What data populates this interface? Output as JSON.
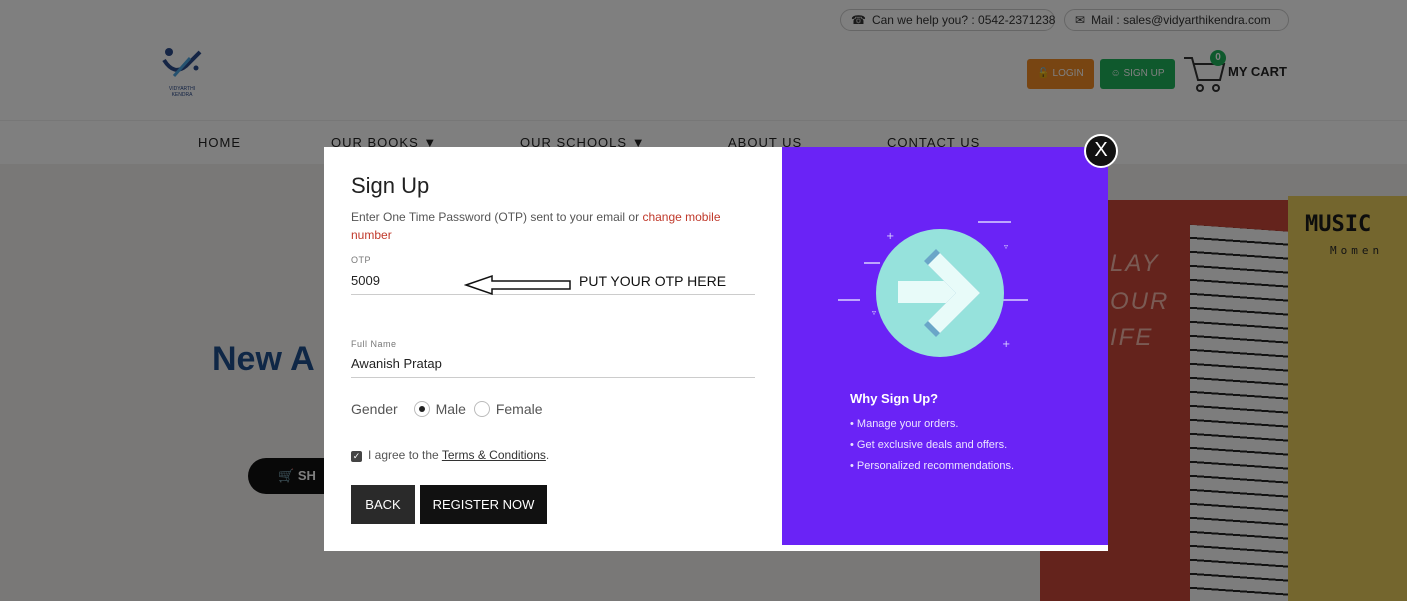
{
  "topbar": {
    "phone": "Can we help you? : 0542-2371238",
    "mail": "Mail : sales@vidyarthikendra.com"
  },
  "header": {
    "logo_text": "VIDYARTHI KENDRA",
    "login_label": "LOGIN",
    "signup_label": "SIGN UP",
    "cart_label": "MY CART",
    "cart_count": "0"
  },
  "nav": {
    "items": [
      "HOME",
      "OUR BOOKS",
      "OUR SCHOOLS",
      "ABOUT US",
      "CONTACT US"
    ]
  },
  "hero": {
    "title": "New A",
    "button": "SH",
    "poster_lines": [
      "LAY",
      "OUR",
      "IFE"
    ],
    "poster2_title": "MUSIC",
    "poster2_sub": "Momen"
  },
  "modal": {
    "close": "X",
    "title": "Sign Up",
    "desc_text": "Enter One Time Password (OTP) sent to your email or ",
    "desc_link": "change mobile number",
    "otp_label": "OTP",
    "otp_value": "5009",
    "annotation": "PUT YOUR OTP HERE",
    "fullname_label": "Full Name",
    "fullname_value": "Awanish Pratap",
    "gender_label": "Gender",
    "gender_options": [
      "Male",
      "Female"
    ],
    "gender_selected": "Male",
    "agree_prefix": "I agree to the ",
    "agree_link": "Terms & Conditions",
    "agree_suffix": ".",
    "back_label": "BACK",
    "register_label": "REGISTER NOW",
    "why_title": "Why Sign Up?",
    "why_items": [
      "• Manage your orders.",
      "• Get exclusive deals and offers.",
      "• Personalized recommendations."
    ],
    "panel_color": "#6a23f6"
  },
  "colors": {
    "login": "#f08a24",
    "signup": "#1eb35a",
    "link": "#c0392b",
    "hero_title": "#1f4e8c"
  }
}
